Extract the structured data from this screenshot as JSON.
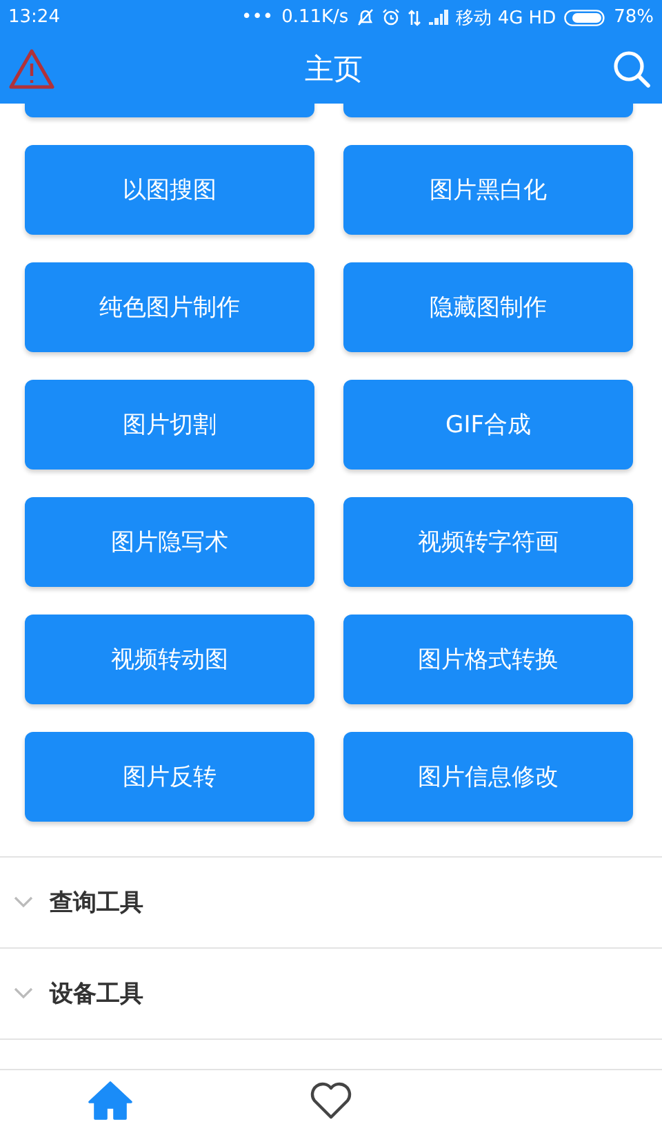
{
  "status_bar": {
    "time": "13:24",
    "dots": "•••",
    "speed": "0.11K/s",
    "carrier": "移动 4G HD",
    "battery": "78%"
  },
  "header": {
    "title": "主页"
  },
  "tools": [
    {
      "label": "以图搜图"
    },
    {
      "label": "图片黑白化"
    },
    {
      "label": "纯色图片制作"
    },
    {
      "label": "隐藏图制作"
    },
    {
      "label": "图片切割"
    },
    {
      "label": "GIF合成"
    },
    {
      "label": "图片隐写术"
    },
    {
      "label": "视频转字符画"
    },
    {
      "label": "视频转动图"
    },
    {
      "label": "图片格式转换"
    },
    {
      "label": "图片反转"
    },
    {
      "label": "图片信息修改"
    }
  ],
  "sections": [
    {
      "label": "查询工具",
      "expanded": false
    },
    {
      "label": "设备工具",
      "expanded": false
    }
  ],
  "nav": [
    {
      "kind": "home",
      "selected": true
    },
    {
      "kind": "favorites",
      "selected": false
    }
  ]
}
